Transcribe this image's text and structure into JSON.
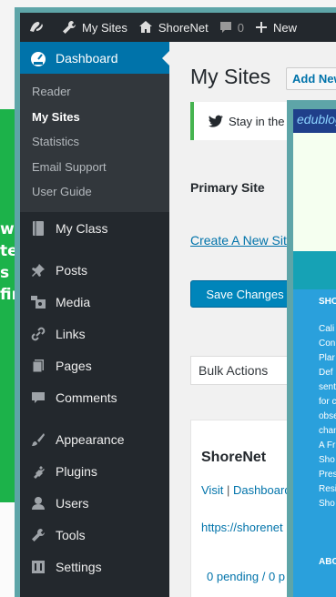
{
  "background": {
    "green_text_lines": [
      "wi",
      "te",
      "s c",
      "fir"
    ]
  },
  "adminbar": {
    "my_sites": "My Sites",
    "site_name": "ShoreNet",
    "comments_count": "0",
    "new_label": "New"
  },
  "sidebar": {
    "dashboard": "Dashboard",
    "submenu": [
      "Reader",
      "My Sites",
      "Statistics",
      "Email Support",
      "User Guide"
    ],
    "items": [
      "My Class",
      "Posts",
      "Media",
      "Links",
      "Pages",
      "Comments",
      "Appearance",
      "Plugins",
      "Users",
      "Tools",
      "Settings"
    ]
  },
  "content": {
    "title": "My Sites",
    "add_new": "Add New",
    "notice_text": "Stay in the loop",
    "primary_site_label": "Primary Site",
    "create_link": "Create A New Site",
    "save_button": "Save Changes",
    "bulk_actions": "Bulk Actions",
    "site": {
      "name": "ShoreNet",
      "visit": "Visit",
      "dashboard": "Dashboard",
      "url": "https://shorenet",
      "pending": "0 pending / 0 p"
    }
  },
  "popup": {
    "brand": "edublogs",
    "heading": "SHO",
    "lines": [
      "Cali",
      "Con",
      "Plar",
      "Def",
      "sent",
      "for c",
      "obse",
      "chan",
      "A Fr",
      "Sho",
      "Pres",
      "Resi",
      "Sho"
    ],
    "footer": "ABO"
  },
  "colors": {
    "adminbar": "#23282d",
    "sidebar_active": "#0073aa",
    "notice_border": "#46b450",
    "primary_button": "#0085ba",
    "frame_border": "#5ea5a8",
    "background_green": "#1cb24a"
  }
}
